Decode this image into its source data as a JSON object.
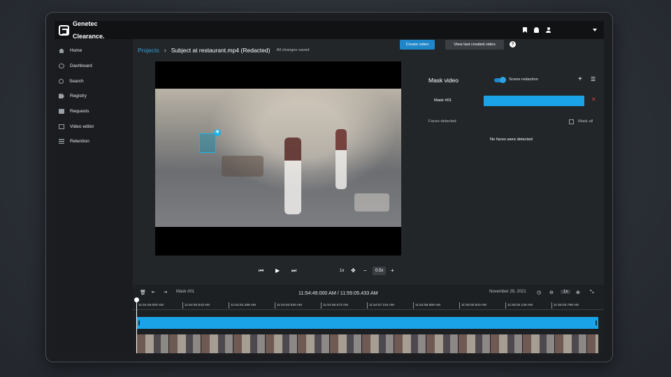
{
  "app": {
    "logo_line1": "Genetec",
    "logo_line2": "Clearance."
  },
  "sidebar": {
    "items": [
      {
        "label": "Home",
        "icon": "home-icon"
      },
      {
        "label": "Dashboard",
        "icon": "dashboard-icon"
      },
      {
        "label": "Search",
        "icon": "search-icon"
      },
      {
        "label": "Registry",
        "icon": "registry-icon"
      },
      {
        "label": "Requests",
        "icon": "requests-icon"
      },
      {
        "label": "Video editor",
        "icon": "video-editor-icon"
      },
      {
        "label": "Retention",
        "icon": "retention-icon"
      }
    ]
  },
  "header": {
    "breadcrumb_projects": "Projects",
    "title": "Subject at restaurant.mp4 (Redacted)",
    "save_status": "All changes saved",
    "create_video": "Create video",
    "view_last": "View last created video",
    "help": "?"
  },
  "player": {
    "speed": "1x",
    "zoom": "0.5x"
  },
  "mask_panel": {
    "title": "Mask video",
    "scene_redaction": "Scene redaction",
    "scene_redaction_on": true,
    "mask_name": "Mask #01",
    "faces_detected": "Faces detected",
    "mask_all": "Mask all",
    "no_faces": "No faces were detected",
    "accent": "#1aa3e6",
    "delete_color": "#e0403a"
  },
  "timeline": {
    "mask_label": "Mask #01",
    "time_range": "11:54:49.000 AM / 11:55:05.433 AM",
    "date": "November 29, 2021",
    "zoom": "1x",
    "ticks": [
      "11:54:49.000 AM",
      "11:54:50.643 AM",
      "11:54:52.286 AM",
      "11:54:53.930 AM",
      "11:54:55.573 AM",
      "11:54:57.216 AM",
      "11:54:58.859 AM",
      "11:55:00.503 AM",
      "11:55:02.146 AM",
      "11:55:03.789 AM"
    ]
  }
}
